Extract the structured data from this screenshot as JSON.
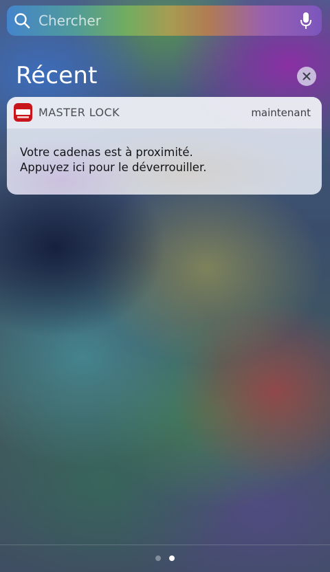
{
  "search": {
    "placeholder": "Chercher"
  },
  "recent": {
    "title": "Récent"
  },
  "notification": {
    "app_name": "MASTER LOCK",
    "time": "maintenant",
    "body_lines": [
      "Votre cadenas est à proximité.",
      "Appuyez ici pour le déverrouiller."
    ],
    "app_icon": "master-lock-app-icon",
    "app_icon_color": "#c8151b"
  },
  "page_indicator": {
    "page_count": 2,
    "current_page": 2
  },
  "icons": {
    "search": "search-icon",
    "microphone": "microphone-icon",
    "clear": "close-icon"
  }
}
